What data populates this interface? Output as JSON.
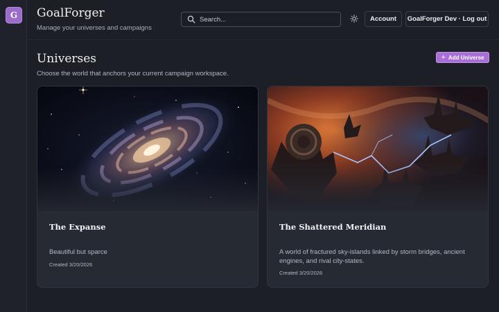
{
  "app": {
    "logo_letter": "G",
    "title": "GoalForger",
    "subtitle": "Manage your universes and campaigns"
  },
  "header": {
    "search_placeholder": "Search...",
    "theme_icon": "sun-icon",
    "account_label": "Account",
    "user_label": "GoalForger Dev · Log out"
  },
  "page": {
    "title": "Universes",
    "subtitle": "Choose the world that anchors your current campaign workspace.",
    "add_button_label": "Add Universe"
  },
  "universes": [
    {
      "name": "The Expanse",
      "description": "Beautiful but sparce",
      "created": "Created 3/20/2026",
      "image": "spiral-galaxy"
    },
    {
      "name": "The Shattered Meridian",
      "description": "A world of fractured sky-islands linked by storm bridges, ancient engines, and rival city-states.",
      "created": "Created 3/20/2026",
      "image": "floating-islands-nebula"
    }
  ],
  "colors": {
    "background": "#1c1f26",
    "card": "#262a33",
    "accent": "#a86fd6",
    "logo": "#9b6cc9"
  }
}
